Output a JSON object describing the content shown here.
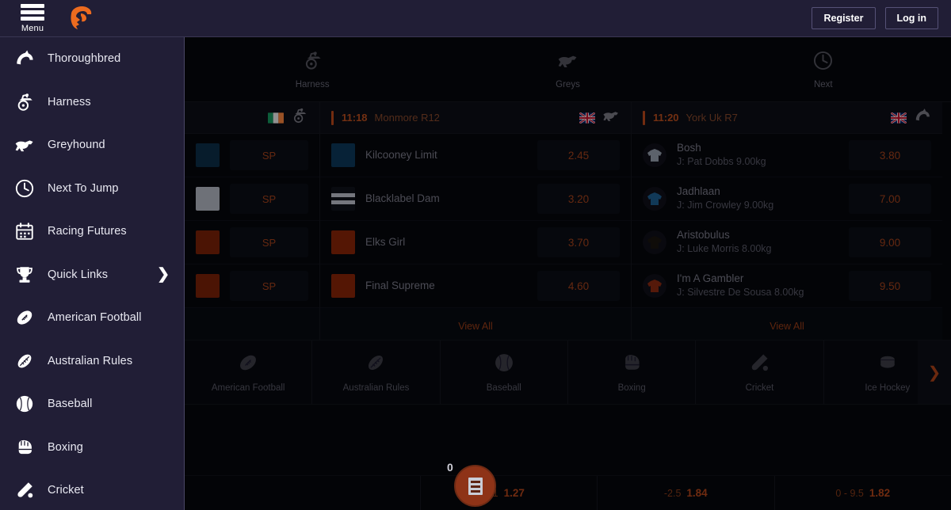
{
  "topbar": {
    "menu_label": "Menu",
    "logo_icon": "jockey-head-logo",
    "register_label": "Register",
    "login_label": "Log in"
  },
  "sidebar": {
    "items": [
      {
        "label": "Thoroughbred",
        "icon": "horse-head-icon",
        "arrow": ""
      },
      {
        "label": "Harness",
        "icon": "harness-sulky-icon",
        "arrow": ""
      },
      {
        "label": "Greyhound",
        "icon": "greyhound-icon",
        "arrow": ""
      },
      {
        "label": "Next To Jump",
        "icon": "clock-icon",
        "arrow": ""
      },
      {
        "label": "Racing Futures",
        "icon": "calendar-icon",
        "arrow": ""
      },
      {
        "label": "Quick Links",
        "icon": "trophy-icon",
        "arrow": "❯"
      },
      {
        "label": "American Football",
        "icon": "american-football-icon",
        "arrow": ""
      },
      {
        "label": "Australian Rules",
        "icon": "aussie-rules-ball-icon",
        "arrow": ""
      },
      {
        "label": "Baseball",
        "icon": "baseball-icon",
        "arrow": ""
      },
      {
        "label": "Boxing",
        "icon": "boxing-glove-icon",
        "arrow": ""
      },
      {
        "label": "Cricket",
        "icon": "cricket-bat-icon",
        "arrow": ""
      }
    ]
  },
  "main": {
    "tabs": [
      {
        "label": "Harness",
        "icon": "harness-sulky-icon"
      },
      {
        "label": "Greys",
        "icon": "greyhound-icon"
      },
      {
        "label": "Next",
        "icon": "clock-icon"
      }
    ],
    "cards": [
      {
        "time": "",
        "name": "",
        "flag": "ireland-flag-icon",
        "type_icon": "harness-sulky-icon",
        "view_all": "",
        "runners": [
          {
            "name": "",
            "sub": "",
            "odds": "SP",
            "silk": "box",
            "silk_color": "#0c2f4a"
          },
          {
            "name": "",
            "sub": "",
            "odds": "SP",
            "silk": "box",
            "silk_color": "#b7bcc8"
          },
          {
            "name": "",
            "sub": "",
            "odds": "SP",
            "silk": "box",
            "silk_color": "#7e2208"
          },
          {
            "name": "",
            "sub": "",
            "odds": "SP",
            "silk": "box",
            "silk_color": "#7e2208"
          }
        ]
      },
      {
        "time": "11:18",
        "name": "Monmore R12",
        "flag": "uk-flag-icon",
        "type_icon": "greyhound-icon",
        "view_all": "View All",
        "runners": [
          {
            "name": "Kilcooney Limit",
            "sub": "",
            "odds": "2.45",
            "silk": "box",
            "silk_color": "#0c3a5c"
          },
          {
            "name": "Blacklabel Dam",
            "sub": "",
            "odds": "3.20",
            "silk": "striped",
            "silk_color": "#c3c7d2"
          },
          {
            "name": "Elks Girl",
            "sub": "",
            "odds": "3.70",
            "silk": "box",
            "silk_color": "#8c2508"
          },
          {
            "name": "Final Supreme",
            "sub": "",
            "odds": "4.60",
            "silk": "box",
            "silk_color": "#8c2508"
          }
        ]
      },
      {
        "time": "11:20",
        "name": "York Uk R7",
        "flag": "uk-flag-icon",
        "type_icon": "horse-head-icon",
        "view_all": "View All",
        "runners": [
          {
            "name": "Bosh",
            "sub": "J: Pat Dobbs 9.00kg",
            "odds": "3.80",
            "silk": "jersey",
            "silk_color": "#9aa3b2"
          },
          {
            "name": "Jadhlaan",
            "sub": "J: Jim Crowley 9.00kg",
            "odds": "7.00",
            "silk": "jersey",
            "silk_color": "#1d5f93"
          },
          {
            "name": "Aristobulus",
            "sub": "J: Luke Morris 8.00kg",
            "odds": "9.00",
            "silk": "jersey",
            "silk_color": "#1a1410"
          },
          {
            "name": "I'm A Gambler",
            "sub": "J: Silvestre De Sousa 8.00kg",
            "odds": "9.50",
            "silk": "jersey",
            "silk_color": "#8e2a12"
          }
        ]
      }
    ],
    "sports": [
      {
        "label": "American Football",
        "icon": "american-football-icon"
      },
      {
        "label": "Australian Rules",
        "icon": "aussie-rules-ball-icon"
      },
      {
        "label": "Baseball",
        "icon": "baseball-icon"
      },
      {
        "label": "Boxing",
        "icon": "boxing-glove-icon"
      },
      {
        "label": "Cricket",
        "icon": "cricket-bat-icon"
      },
      {
        "label": "Ice Hockey",
        "icon": "ice-hockey-puck-icon"
      }
    ],
    "sports_next_icon": "chevron-right-icon"
  },
  "bottombar": {
    "betslip_count": "0",
    "betslip_icon": "betslip-receipt-icon",
    "markets": [
      {
        "line": "1",
        "odds": "1.27"
      },
      {
        "line": "-2.5",
        "odds": "1.84"
      },
      {
        "line": "0 - 9.5",
        "odds": "1.82"
      }
    ]
  },
  "colors": {
    "accent_orange": "#c0511f",
    "sidebar_bg": "#211e36",
    "main_bg": "#05070d",
    "card_head_bg": "#0c0e17"
  }
}
